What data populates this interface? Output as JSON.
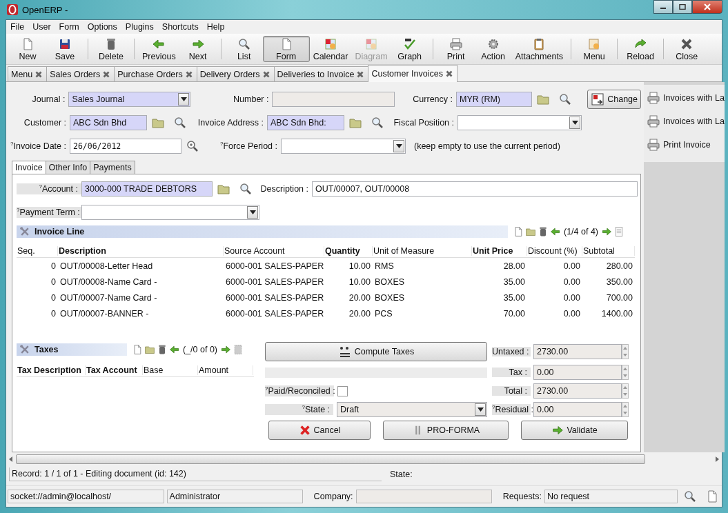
{
  "window": {
    "title": "OpenERP -"
  },
  "menu_bar": [
    "File",
    "User",
    "Form",
    "Options",
    "Plugins",
    "Shortcuts",
    "Help"
  ],
  "toolbar_groups": [
    {
      "buttons": [
        {
          "label": "New",
          "selected": false,
          "disabled": false
        },
        {
          "label": "Save",
          "selected": false,
          "disabled": false
        }
      ]
    },
    {
      "buttons": [
        {
          "label": "Delete",
          "selected": false,
          "disabled": false
        }
      ]
    },
    {
      "buttons": [
        {
          "label": "Previous",
          "selected": false,
          "disabled": false
        },
        {
          "label": "Next",
          "selected": false,
          "disabled": false
        }
      ]
    },
    {
      "buttons": [
        {
          "label": "List",
          "selected": false,
          "disabled": false
        },
        {
          "label": "Form",
          "selected": true,
          "disabled": false
        },
        {
          "label": "Calendar",
          "selected": false,
          "disabled": false
        },
        {
          "label": "Diagram",
          "selected": false,
          "disabled": true
        },
        {
          "label": "Graph",
          "selected": false,
          "disabled": false
        }
      ]
    },
    {
      "buttons": [
        {
          "label": "Print",
          "selected": false,
          "disabled": false
        },
        {
          "label": "Action",
          "selected": false,
          "disabled": false
        },
        {
          "label": "Attachments",
          "selected": false,
          "disabled": false
        }
      ]
    },
    {
      "buttons": [
        {
          "label": "Menu",
          "selected": false,
          "disabled": false
        }
      ]
    },
    {
      "buttons": [
        {
          "label": "Reload",
          "selected": false,
          "disabled": false
        }
      ]
    },
    {
      "buttons": [
        {
          "label": "Close",
          "selected": false,
          "disabled": false
        }
      ]
    }
  ],
  "tabs": [
    {
      "label": "Menu",
      "selected": false
    },
    {
      "label": "Sales Orders",
      "selected": false
    },
    {
      "label": "Purchase Orders",
      "selected": false
    },
    {
      "label": "Delivery Orders",
      "selected": false
    },
    {
      "label": "Deliveries to Invoice",
      "selected": false
    },
    {
      "label": "Customer Invoices",
      "selected": true
    }
  ],
  "header": {
    "journal": {
      "label": "Journal :",
      "value": "Sales Journal"
    },
    "number": {
      "label": "Number :"
    },
    "currency": {
      "label": "Currency :",
      "value": "MYR (RM)"
    },
    "change_button": "Change",
    "customer": {
      "label": "Customer :",
      "value": "ABC Sdn Bhd"
    },
    "invoice_address": {
      "label": "Invoice Address :",
      "value": "ABC Sdn Bhd:"
    },
    "fiscal_position": {
      "label": "Fiscal Position :"
    },
    "invoice_date": {
      "label": "$^{?}$Invoice Date :",
      "value": "26/06/2012"
    },
    "force_period": {
      "label": "$^{?}$Force Period :"
    },
    "hint": "(keep empty to use the current period)"
  },
  "subtabs": [
    {
      "label": "Invoice",
      "selected": true
    },
    {
      "label": "Other Info",
      "selected": false
    },
    {
      "label": "Payments",
      "selected": false
    }
  ],
  "invoice": {
    "account": {
      "label": "$^{?}$Account :",
      "value": "3000-000 TRADE DEBTORS"
    },
    "description": {
      "label": "Description :",
      "value": "OUT/00007, OUT/00008"
    },
    "payment_term": {
      "label": "$^{?}$Payment Term :"
    },
    "lines": {
      "title": "Invoice Line",
      "pager": "(1/4 of 4)",
      "columns": [
        {
          "label": "Seq.",
          "bold": false
        },
        {
          "label": "Description",
          "bold": true
        },
        {
          "label": "Source Account",
          "bold": false
        },
        {
          "label": "Quantity",
          "bold": true
        },
        {
          "label": "Unit of Measure",
          "bold": false
        },
        {
          "label": "Unit Price",
          "bold": true
        },
        {
          "label": "Discount (%)",
          "bold": false
        },
        {
          "label": "Subtotal",
          "bold": false
        }
      ],
      "rows": [
        [
          "0",
          "OUT/00008-Letter Head",
          "6000-001 SALES-PAPER",
          "10.00",
          "RMS",
          "28.00",
          "0.00",
          "280.00"
        ],
        [
          "0",
          "OUT/00008-Name Card -",
          "6000-001 SALES-PAPER",
          "10.00",
          "BOXES",
          "35.00",
          "0.00",
          "350.00"
        ],
        [
          "0",
          "OUT/00007-Name Card -",
          "6000-001 SALES-PAPER",
          "20.00",
          "BOXES",
          "35.00",
          "0.00",
          "700.00"
        ],
        [
          "0",
          "OUT/00007-BANNER -",
          "6000-001 SALES-PAPER",
          "20.00",
          "PCS",
          "70.00",
          "0.00",
          "1400.00"
        ]
      ]
    }
  },
  "taxes": {
    "title": "Taxes",
    "pager": "(_/0 of 0)",
    "columns": [
      {
        "label": "Tax Description",
        "bold": true
      },
      {
        "label": "Tax Account",
        "bold": true
      },
      {
        "label": "Base",
        "bold": false
      },
      {
        "label": "Amount",
        "bold": false
      }
    ]
  },
  "compute_taxes_button": "Compute Taxes",
  "totals": [
    {
      "label": "Untaxed :",
      "value": "2730.00"
    },
    {
      "label": "Tax :",
      "value": "0.00"
    },
    {
      "label": "Total :",
      "value": "2730.00"
    },
    {
      "label": "$^{?}$Residual :",
      "value": "0.00"
    }
  ],
  "paid_reconciled": {
    "label": "$^{?}$Paid/Reconciled :",
    "checked": false
  },
  "state": {
    "label": "$^{?}$State :",
    "value": "Draft"
  },
  "actions": [
    "Cancel",
    "PRO-FORMA",
    "Validate"
  ],
  "side_panel": [
    "Invoices with La",
    "Invoices with La",
    "Print Invoice"
  ],
  "status": {
    "record": "Record: 1 / 1 of 1 - Editing document (id: 142)",
    "state_label": "State:",
    "connection": "socket://admin@localhost/",
    "user": "Administrator",
    "company_label": "Company:",
    "requests_label": "Requests:",
    "requests": "No request"
  }
}
